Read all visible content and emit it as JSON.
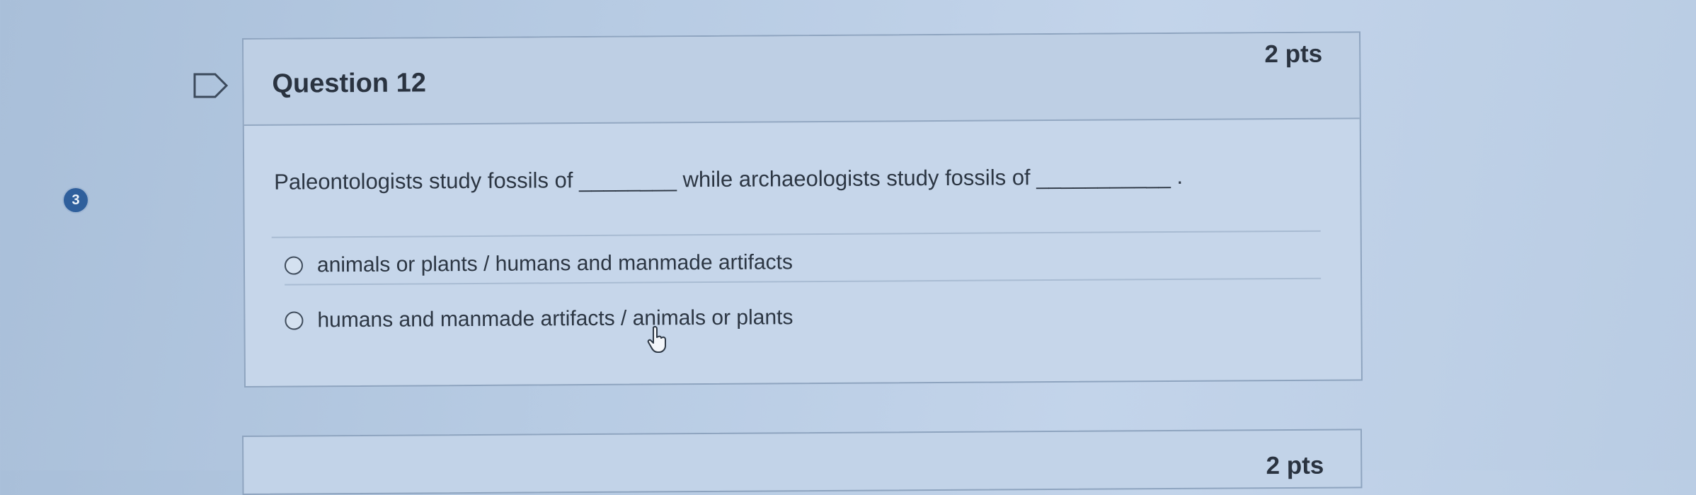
{
  "question_number_badge": "3",
  "question": {
    "title": "Question 12",
    "points": "2 pts",
    "prompt": "Paleontologists study fossils of ________ while archaeologists study fossils of ___________ .",
    "options": [
      {
        "label": "animals or plants / humans and manmade artifacts"
      },
      {
        "label": "humans and manmade artifacts / animals or plants"
      }
    ]
  },
  "next_question": {
    "points": "2 pts"
  },
  "icons": {
    "flag": "flag-question-icon",
    "cursor": "mouse-pointer-icon"
  },
  "colors": {
    "badge": "#2f5f9c",
    "card_background": "#c6d6ea",
    "text": "#2c3643"
  }
}
